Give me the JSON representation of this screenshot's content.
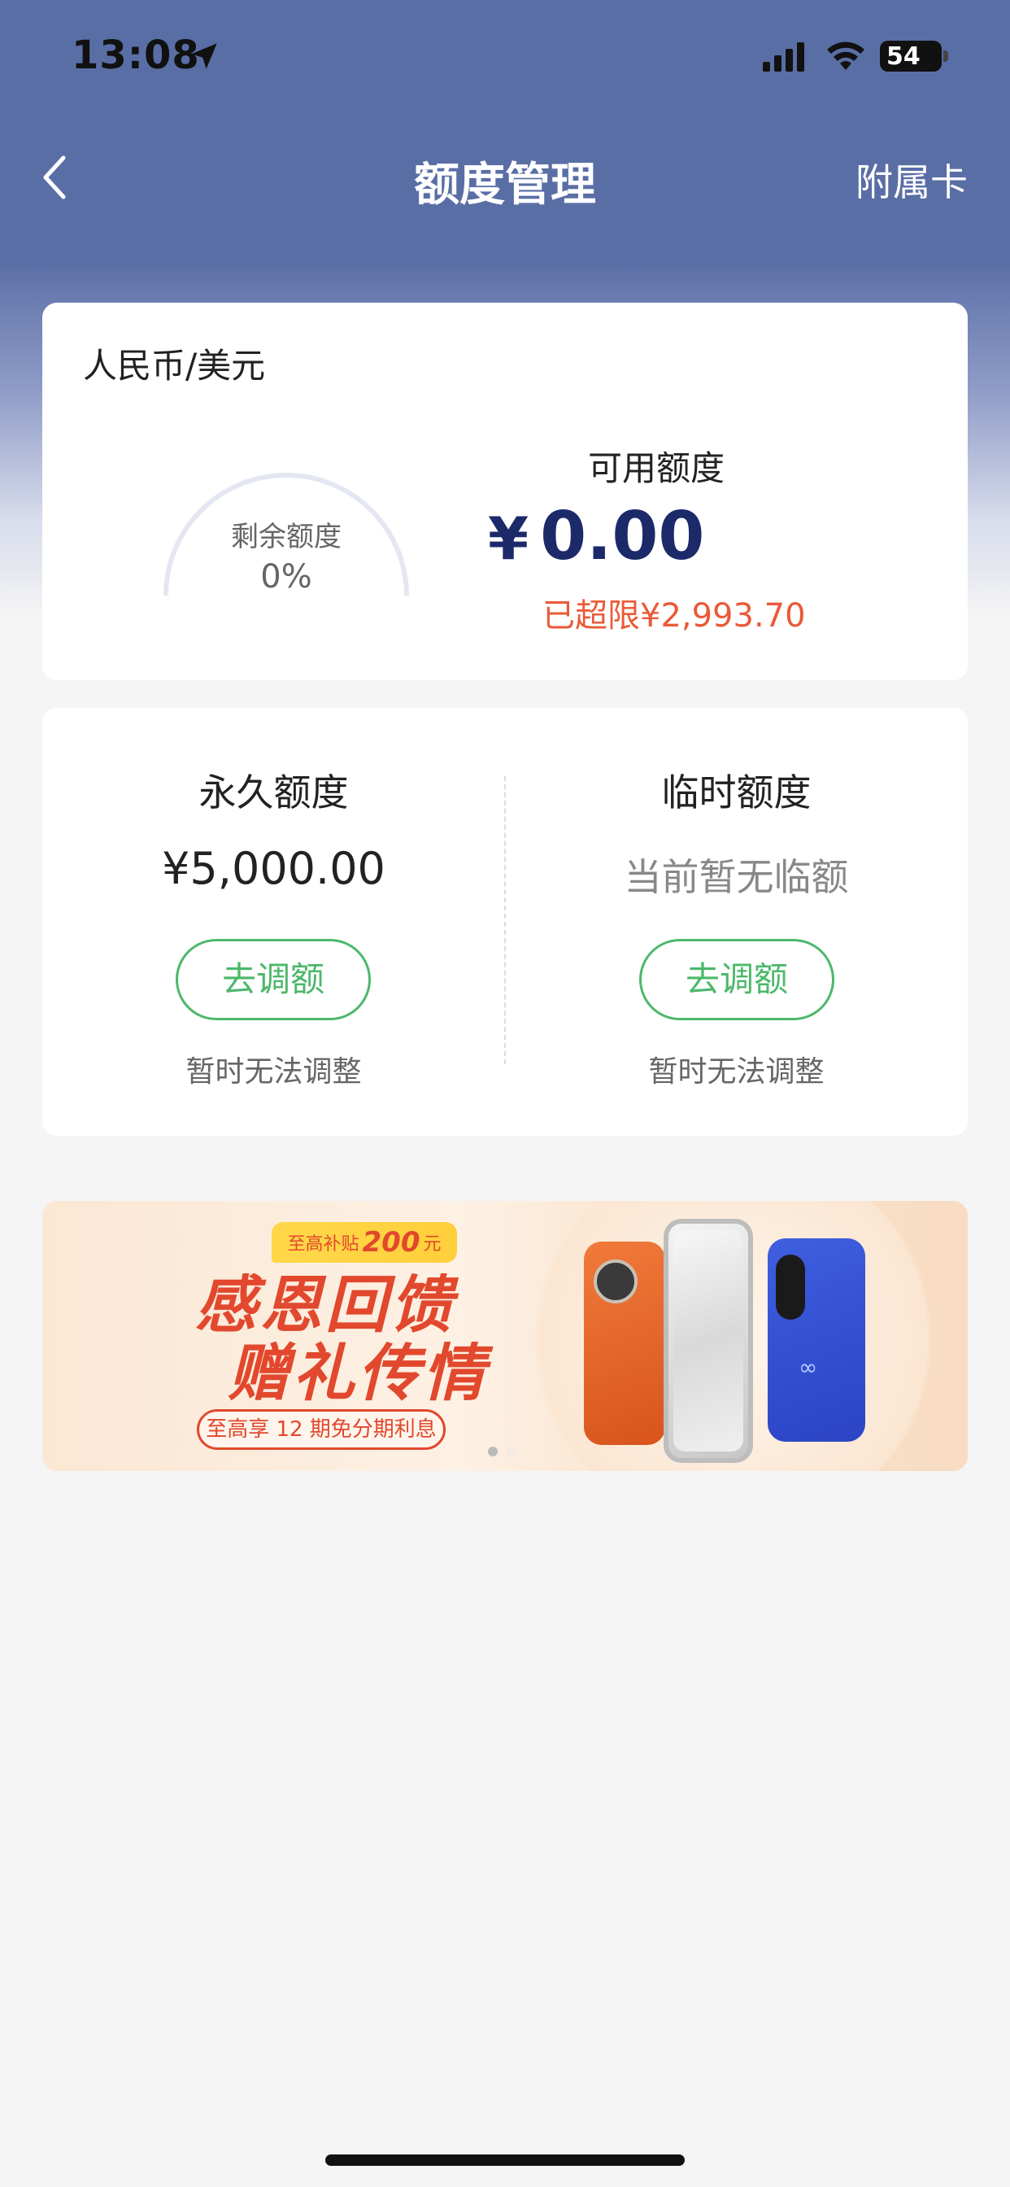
{
  "status_bar": {
    "time": "13:08",
    "battery": "54"
  },
  "nav": {
    "title": "额度管理",
    "right_label": "附属卡"
  },
  "limit_card": {
    "currency": "人民币/美元",
    "gauge_label": "剩余额度",
    "gauge_value": "0%",
    "remaining_fraction": 0,
    "available_label": "可用额度",
    "available_symbol": "¥",
    "available_amount": "0.00",
    "over_limit": "已超限¥2,993.70"
  },
  "limit_types": {
    "permanent": {
      "title": "永久额度",
      "amount": "¥5,000.00",
      "button": "去调额",
      "note": "暂时无法调整"
    },
    "temporary": {
      "title": "临时额度",
      "amount": "当前暂无临额",
      "button": "去调额",
      "note": "暂时无法调整"
    }
  },
  "banner": {
    "badge_prefix": "至高补贴",
    "badge_amount": "200",
    "badge_suffix": "元",
    "title_line1": "感恩回馈",
    "title_line2": "赠礼传情",
    "pill": "至高享 12 期免分期利息",
    "page_count": 2,
    "active_page": 1
  },
  "colors": {
    "header_bg": "#5a6ea6",
    "accent_green": "#4cb86a",
    "amount_navy": "#1c2a6a",
    "warning_orange": "#ea5a38"
  }
}
